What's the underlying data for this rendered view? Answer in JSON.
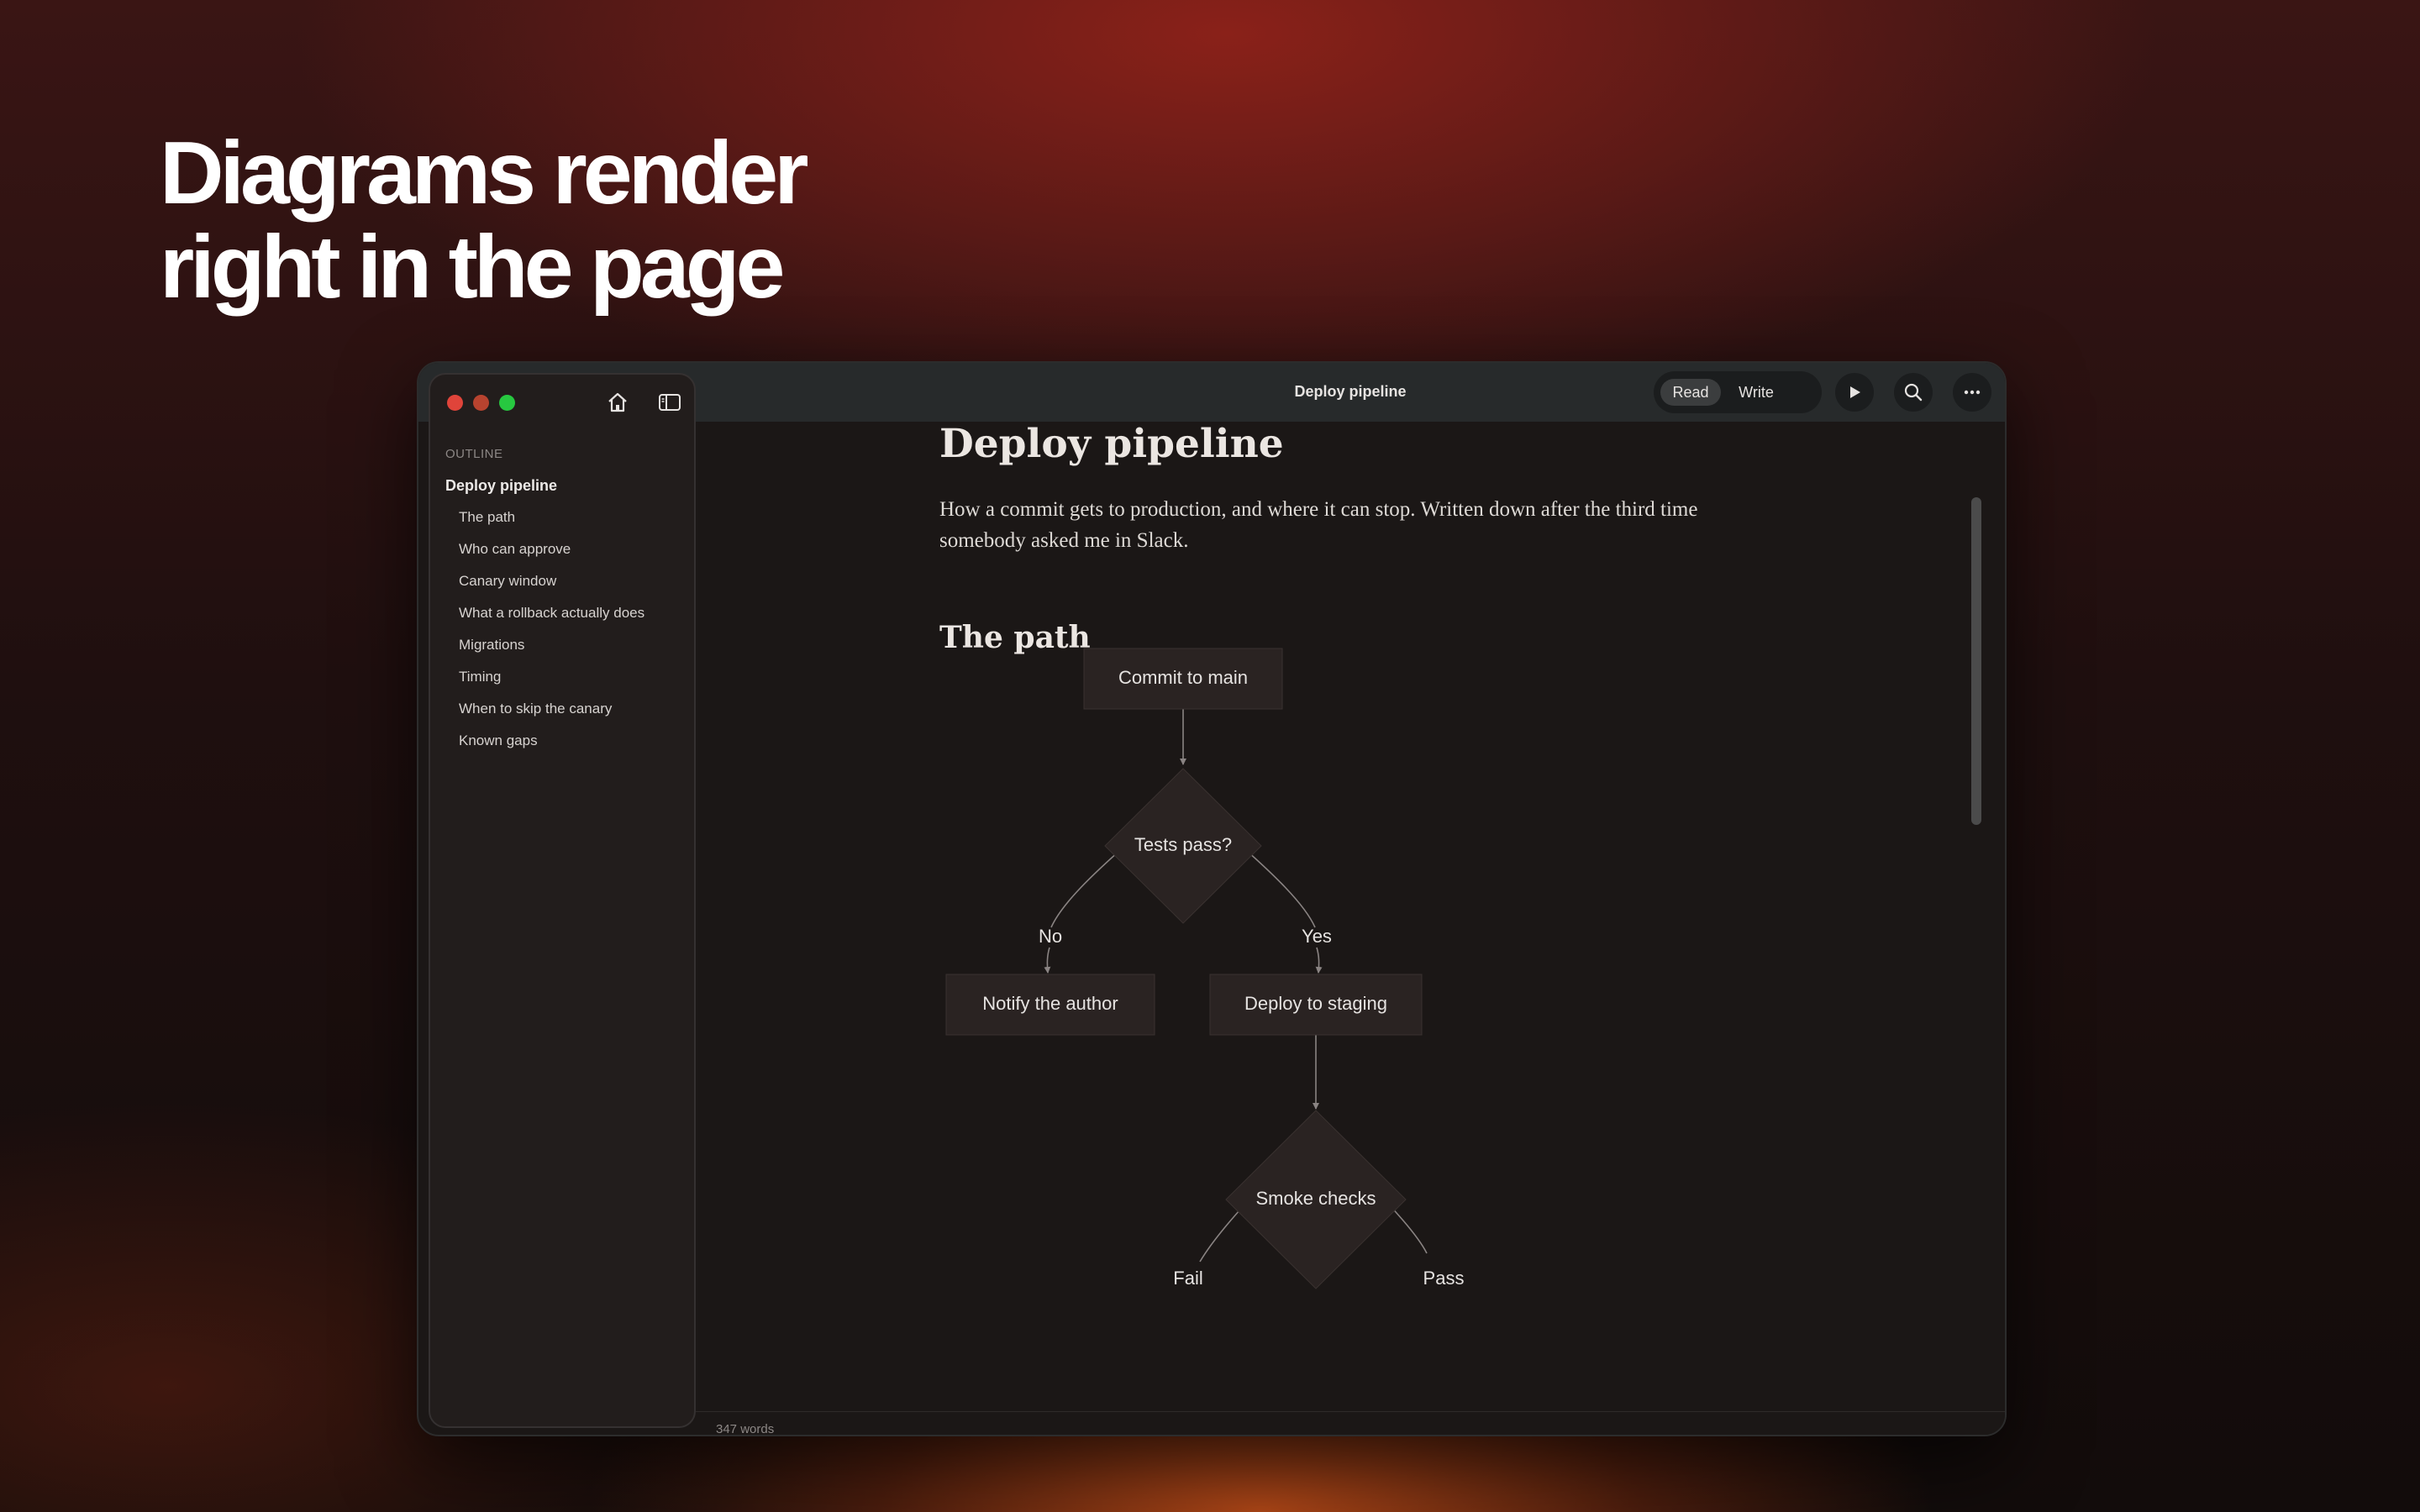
{
  "headline": {
    "line1": "Diagrams render",
    "line2": "right in the page"
  },
  "window": {
    "title": "Deploy pipeline"
  },
  "toolbar": {
    "mode_read": "Read",
    "mode_write": "Write",
    "active_mode": "Read"
  },
  "outline": {
    "label": "OUTLINE",
    "items": [
      {
        "label": "Deploy pipeline"
      },
      {
        "label": "The path"
      },
      {
        "label": "Who can approve"
      },
      {
        "label": "Canary window"
      },
      {
        "label": "What a rollback actually does"
      },
      {
        "label": "Migrations"
      },
      {
        "label": "Timing"
      },
      {
        "label": "When to skip the canary"
      },
      {
        "label": "Known gaps"
      }
    ]
  },
  "document": {
    "title": "Deploy pipeline",
    "intro": "How a commit gets to production, and where it can stop. Written down after the third time somebody asked me in Slack.",
    "section": "The path"
  },
  "diagram": {
    "nodes": {
      "commit": "Commit to main",
      "tests": "Tests pass?",
      "notify": "Notify the author",
      "staging": "Deploy to staging",
      "smoke": "Smoke checks"
    },
    "edges": {
      "no": "No",
      "yes": "Yes",
      "fail": "Fail",
      "pass": "Pass"
    }
  },
  "status": {
    "word_count": "347 words"
  },
  "colors": {
    "node_fill": "#2a2322",
    "edge": "#8a8483",
    "accent_green": "#27c840",
    "accent_red": "#e0443a"
  },
  "icons": [
    "home-icon",
    "sidebar-toggle-icon",
    "play-icon",
    "search-icon",
    "more-icon"
  ]
}
